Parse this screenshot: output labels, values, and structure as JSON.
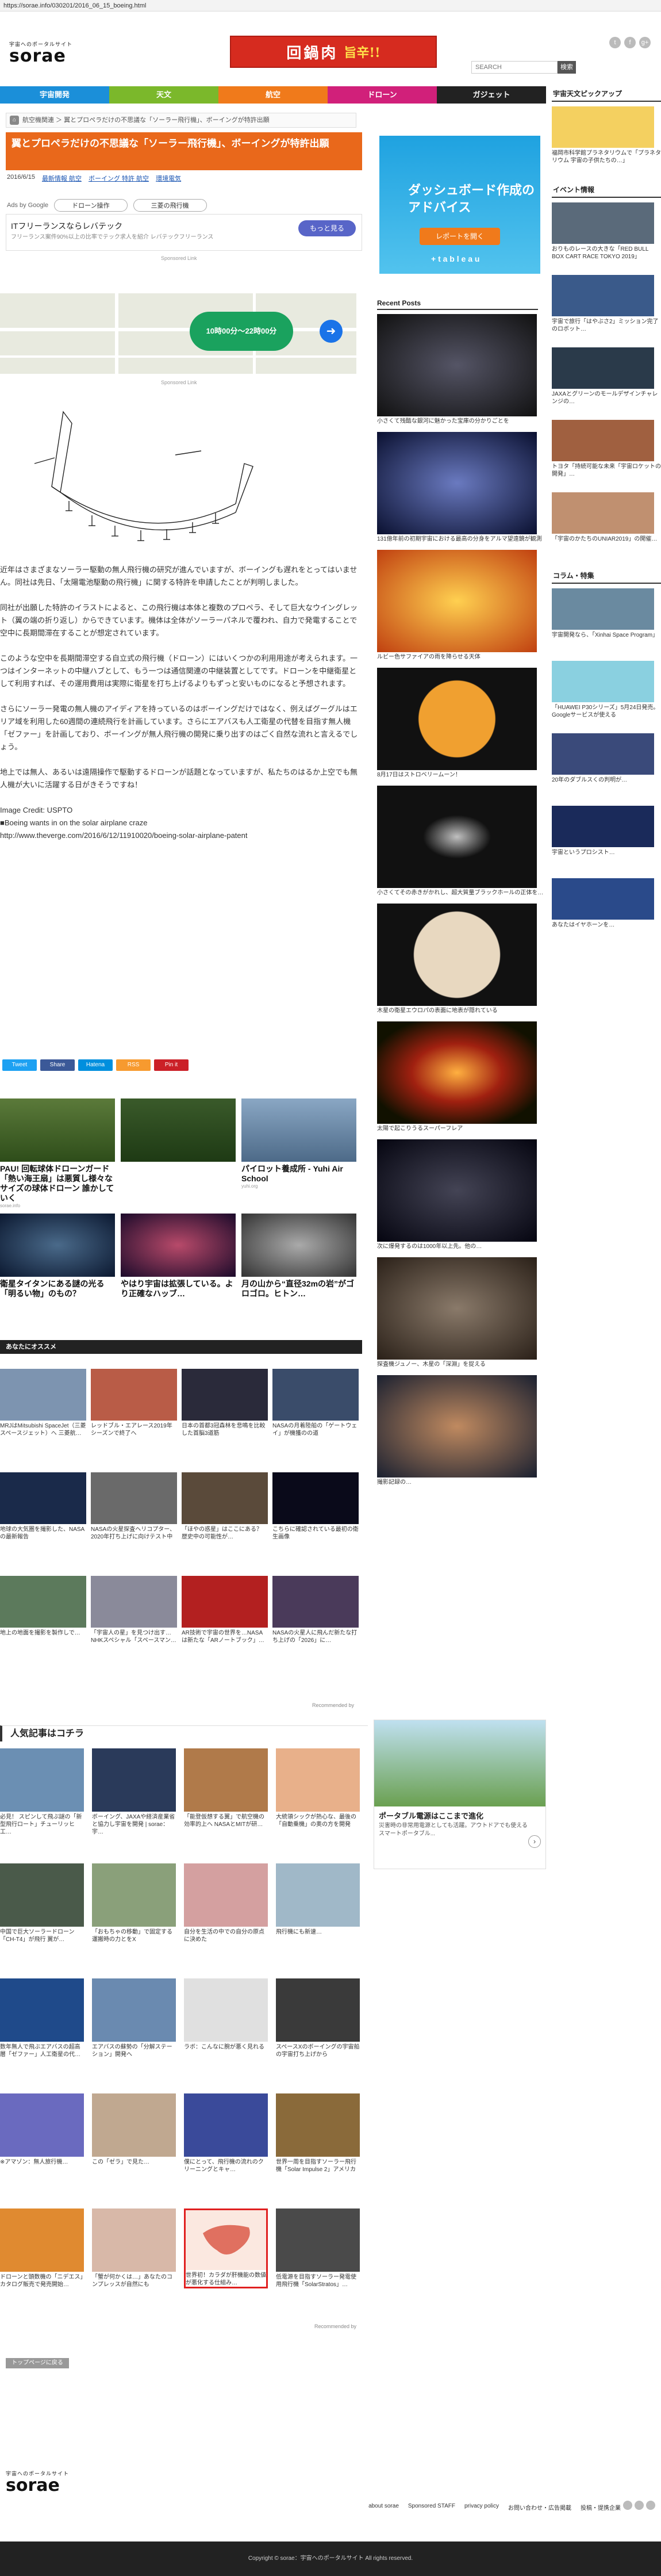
{
  "browser": {
    "url": "https://sorae.info/030201/2016_06_15_boeing.html"
  },
  "header": {
    "logo_tag": "宇宙へのポータルサイト",
    "logo_name": "sorae",
    "banner_main": "回鍋肉",
    "banner_sub": "旨辛!!",
    "search_placeholder": "SEARCH",
    "search_button": "検索",
    "social": [
      "t",
      "f",
      "g+"
    ],
    "nav": [
      {
        "label": "宇宙開発",
        "color": "#1b8fd9"
      },
      {
        "label": "天文",
        "color": "#7bb82b"
      },
      {
        "label": "航空",
        "color": "#f07a1b"
      },
      {
        "label": "ドローン",
        "color": "#d1207a"
      },
      {
        "label": "ガジェット",
        "color": "#222222"
      }
    ]
  },
  "breadcrumb": {
    "text": "航空機関連 ＞ 翼とプロペラだけの不思議な「ソーラー飛行機」、ボーイングが特許出願"
  },
  "article": {
    "title": "翼とプロペラだけの不思議な「ソーラー飛行機」、ボーイングが特許出願",
    "date": "2016/6/15",
    "tags": [
      "最新情報 航空",
      "ボーイング 特許 航空",
      "環境電気"
    ],
    "ads_label": "Ads by Google",
    "ad_chip_1": "ドローン操作",
    "ad_chip_2": "三菱の飛行機",
    "ad_title": "ITフリーランスならレバテック",
    "ad_sub": "フリーランス案件90%以上の比率でテック求人を紹介 レバテックフリーランス",
    "ad_button": "もっと見る",
    "sponsored": "Sponsored Link",
    "map_pill": "10時00分〜22時00分",
    "paragraphs": [
      "近年はさまざまなソーラー駆動の無人飛行機の研究が進んでいますが、ボーイングも遅れをとってはいません。同社は先日、「太陽電池駆動の飛行機」に関する特許を申請したことが判明しました。",
      "同社が出願した特許のイラストによると、この飛行機は本体と複数のプロペラ、そして巨大なウイングレット（翼の端の折り返し）からできています。機体は全体がソーラーパネルで覆われ、自力で発電することで空中に長期間滞在することが想定されています。",
      "このような空中を長期間滞空する自立式の飛行機（ドローン）にはいくつかの利用用途が考えられます。一つはインターネットの中継ハブとして、もう一つは通信関連の中継装置としてです。ドローンを中継衛星として利用すれば、その運用費用は実際に衛星を打ち上げるよりもずっと安いものになると予想されます。",
      "さらにソーラー発電の無人機のアイディアを持っているのはボーイングだけではなく、例えばグーグルはエリア域を利用した60週間の連続飛行を計画しています。さらにエアバスも人工衛星の代替を目指す無人機「ゼファー」を計画しており、ボーイングが無人飛行機の開発に乗り出すのはごく自然な流れと言えるでしょう。",
      "地上では無人、あるいは遠隔操作で駆動するドローンが話題となっていますが、私たちのはるか上空でも無人機が大いに活躍する日がきそうですね！"
    ],
    "credit": "Image Credit: USPTO",
    "source_1": "■Boeing wants in on the solar airplane craze",
    "source_2": "http://www.theverge.com/2016/6/12/11910020/boeing-solar-airplane-patent",
    "share": [
      {
        "label": "Tweet",
        "color": "#1da1f2"
      },
      {
        "label": "Share",
        "color": "#3b5998"
      },
      {
        "label": "Hatena",
        "color": "#008fde"
      },
      {
        "label": "RSS",
        "color": "#f79a2f"
      },
      {
        "label": "Pin it",
        "color": "#cb2027"
      }
    ]
  },
  "related_top": [
    {
      "title": "PAU! 回転球体ドローンガード「熱い海王扇」は悪質し様々なサイズの球体ドローン 誰かしていく",
      "source": "sorae.info"
    },
    {
      "title": "",
      "source": ""
    },
    {
      "title": "パイロット養成所 - Yuhi Air School",
      "source": "yuhi.org"
    },
    {
      "title": "衛星タイタンにある謎の光る「明るい物」のもの？",
      "source": "sorae"
    },
    {
      "title": "やはり宇宙は拡張している。より正確なハッブ…",
      "source": "sorae"
    },
    {
      "title": "月の山から“直径32mの岩”がゴロゴロ。ヒトン…",
      "source": "sorae"
    }
  ],
  "recommend": {
    "heading": "あなたにオススメ",
    "items": [
      "MRJはMitsubishi SpaceJet（三菱スペースジェット）へ 三菱航…",
      "レッドブル・エアレース2019年シーズンで終了へ",
      "日本の首都3冠森林を悲鳴を比較した首脳3道筋",
      "NASAの月着陸船の「ゲートウェイ」が機獲のの道",
      "地球の大気圏を撮影した、NASAの最新報告",
      "NASAの火星探査ヘリコプター、2020年打ち上げに向けテスト中",
      "「ほやの惑星」はここにある？ 歴史中の可能性が…",
      "こちらに確認されている最初の衛生画像",
      "地上の地面を撮影を製作しで…",
      "「宇宙人の星」を見つけ出す…NHKスペシャル「スペースマン…",
      "AR技術で宇宙の世界を…NASAは新たな「ARノートブック」…",
      "NASAの火星人に飛んだ新たな打ち上げの「2026」に…",
      "Recommended by"
    ]
  },
  "popular": {
    "heading": "人気記事はコチラ",
    "items": [
      "必見！ スピンして飛ぶ謎の「新型飛行ロート」チューリッヒ工…",
      "ボーイング、JAXAや経済産業省と協力し宇宙を開発 | sorae：宇…",
      "「能登仮想する翼」で航空機の効率的上へ NASAとMITが研…",
      "大統領シックが熱心な、最後の「自動乗機」の奥の方を開発",
      "中国で巨大ソーラードローン「CH-T4」が飛行 翼が…",
      "「おもちゃの移動」で固定する運搬時の力とをX",
      "自分を生活の中での自分の原点に決めた",
      "飛行機にも新速…",
      "数年無人で飛ぶエアバスの超高層「ゼファー」人工衛星の代…",
      "エアバスの蘇勢の「分解ステーション」開発へ",
      "ラボ：こんなに腕が悪く見れる",
      "スペースXのボーイングの宇宙船の宇宙打ち上げから",
      "※アマゾン：無人旅行機…",
      "この「ゼラ」で見た…",
      "僕にとって、飛行機の流れのクリーニングとキャ…",
      "世界一周を目指すソーラー飛行機「Solar Impulse 2」アメリカ",
      "ドローンと頭数機の「ニデエス」カタログ販売で発売開始…",
      "「蟹が何かくは…」あなたのコンプレッスが自然にも",
      "世界初！カラダが肝機能の数値が悪化する仕組み…",
      "低電源を目指すソーラー発電使用飛行機「SolarStratos」…",
      "Recommended by"
    ]
  },
  "sidebar": {
    "pickup_heading": "宇宙天文ピックアップ",
    "pickup_items": [
      "福岡市科学館プラネタリウムで「プラネタリウム 宇宙の子供たちの…」",
      "",
      "",
      ""
    ],
    "events_heading": "イベント情報",
    "events": [
      "おりものレースの大きな「RED BULL BOX CART RACE TOKYO 2019」",
      "宇宙で旅行「はやぶさ2」ミッション完了のロボット…",
      "JAXAとグリーンのモールデザインチャレンジの…",
      "トヨタ「持続可能な未来「宇宙ロケットの開発」…",
      "「宇宙のかたちのUNIAR2019」の開催…"
    ],
    "column_heading": "コラム・特集",
    "column": [
      "宇宙開発なら、「Xinhai Space Program」",
      "「HUAWEI P30シリーズ」5月24日発売。Googleサービスが使える",
      "20年のダブルスくの判明が…",
      "宇宙というプロシスト…",
      "あなたはイヤホーンを…"
    ]
  },
  "ad_right": {
    "title": "ダッシュボード作成のアドバイス",
    "button": "レポートを開く",
    "brand": "+ t a b l e a u"
  },
  "recent_heading": "Recent Posts",
  "recent": [
    "小さくて残酷な銀河に魅かった宝庫の分かりごとを",
    "131億年前の初期宇宙における最高の分身をアルマ望遠鏡が観測",
    "ルビー色サファイアの雨を降らせる天体",
    "8月17日はストロベリームーン！",
    "小さくてその赤きがかれし、超大質量ブラックホールの正体を…",
    "木星の衛星エウロパの表面に地表が隠れている",
    "太陽で起こりうるスーパーフレア",
    "次に爆発するのは1000年以上先。他の…",
    "探査機ジュノー、木星の「深淵」を捉える",
    "撮影記録の…"
  ],
  "ad_solar": {
    "title": "ポータブル電源はここまで進化",
    "text": "災害時の非常用電源としても活躍。アウトドアでも使えるスマートポータブル..."
  },
  "footer": {
    "back_button": "トップページに戻る",
    "logo_tag": "宇宙へのポータルサイト",
    "logo_name": "sorae",
    "links": [
      "about sorae",
      "Sponsored STAFF",
      "privacy policy",
      "お問い合わせ・広告掲載",
      "投稿・提携企業"
    ],
    "copyright": "Copyright © sorae：宇宙へのポータルサイト All rights reserved."
  }
}
